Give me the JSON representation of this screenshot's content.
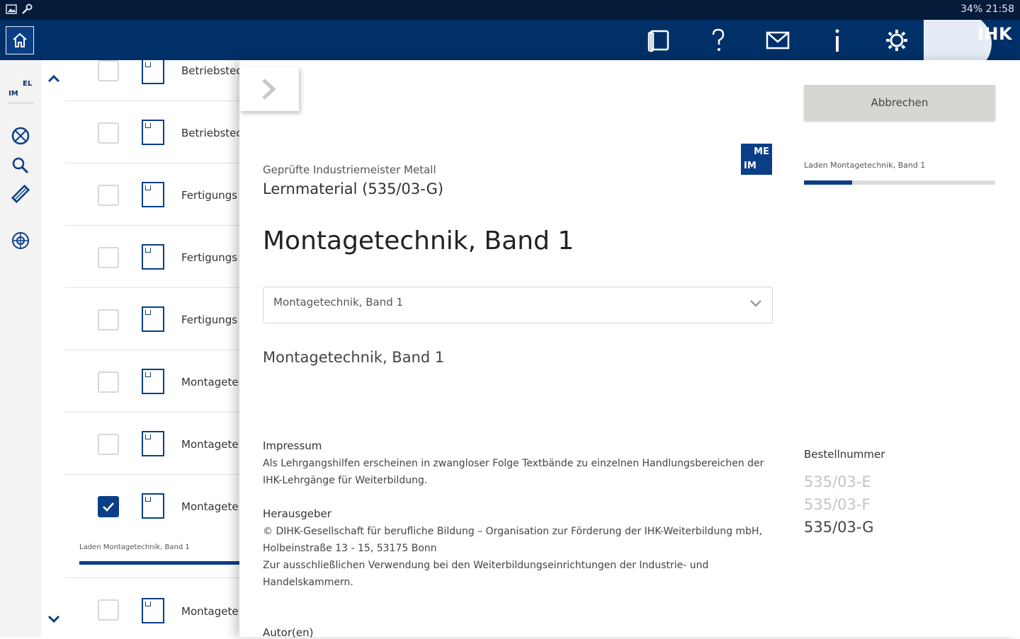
{
  "status_bar": {
    "right_text": "34% 21:58"
  },
  "appbar": {
    "logo_text": "IHK"
  },
  "rail": {
    "logo_el": "EL",
    "logo_im": "IM"
  },
  "list": {
    "rows": [
      {
        "label": "Betriebstec",
        "checked": false
      },
      {
        "label": "Betriebstec",
        "checked": false
      },
      {
        "label": "Fertigungs",
        "checked": false
      },
      {
        "label": "Fertigungs",
        "checked": false
      },
      {
        "label": "Fertigungs",
        "checked": false
      },
      {
        "label": "Montagete",
        "checked": false
      },
      {
        "label": "Montagete",
        "checked": false
      },
      {
        "label": "Montagete",
        "checked": true
      },
      {
        "label": "Montagete",
        "checked": false
      }
    ],
    "progress_label": "Laden Montagetechnik, Band 1"
  },
  "detail": {
    "badge_top": "ME",
    "badge_bottom": "IM",
    "subtitle": "Geprüfte Industriemeister Metall",
    "material": "Lernmaterial (535/03-G)",
    "title": "Montagetechnik, Band 1",
    "select_value": "Montagetechnik, Band 1",
    "description": "Montagetechnik, Band 1",
    "impressum_heading": "Impressum",
    "impressum_text": "Als Lehrgangshilfen erscheinen in zwangloser Folge Textbände zu einzelnen Handlungsbereichen der IHK-Lehrgänge für Weiterbildung.",
    "herausgeber_heading": "Herausgeber",
    "herausgeber_text": "© DIHK-Gesellschaft für berufliche Bildung – Organisation zur Förderung der IHK-Weiterbildung mbH, Holbeinstraße 13 - 15, 53175 Bonn",
    "herausgeber_text2": "Zur ausschließlichen Verwendung bei den Weiterbildungseinrichtungen der Industrie- und Handelskammern.",
    "autoren_heading": "Autor(en)"
  },
  "side": {
    "cancel_label": "Abbrechen",
    "download_label": "Laden Montagetechnik, Band 1",
    "download_progress": 0.25,
    "order_heading": "Bestellnummer",
    "order_numbers": [
      "535/03-E",
      "535/03-F",
      "535/03-G"
    ]
  },
  "colors": {
    "primary": "#003067",
    "accent": "#0b3e87",
    "status_bar": "#061a3a"
  }
}
